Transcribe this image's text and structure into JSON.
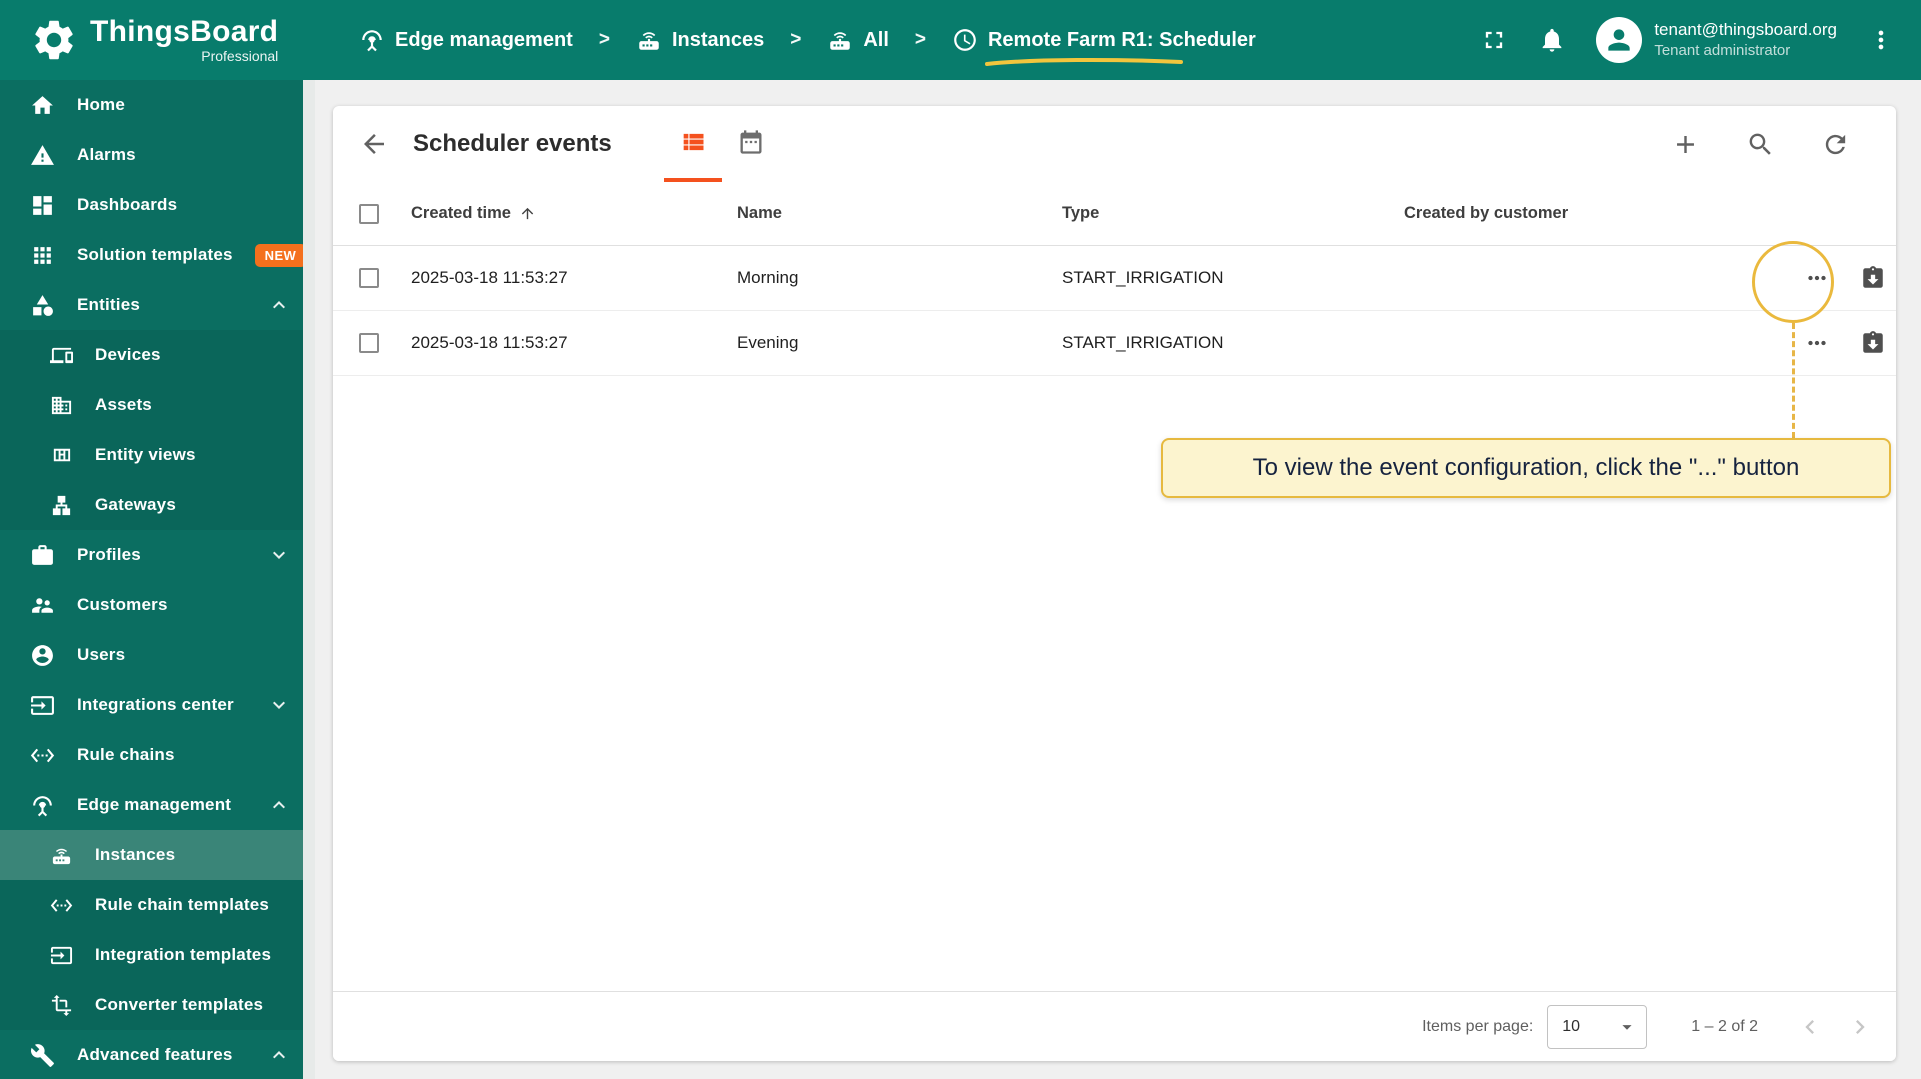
{
  "colors": {
    "header_bg": "#087c6c",
    "sidebar_bg": "#0b6e61",
    "sidebar_selected_bg": "#3a8578",
    "accent_orange": "#f4511e",
    "badge_orange": "#f4701d",
    "annotation_yellow": "#eab93d",
    "tooltip_bg": "#fcf4cf",
    "tooltip_text": "#16233f"
  },
  "header": {
    "logo_title": "ThingsBoard",
    "logo_subtitle": "Professional",
    "separator": ">",
    "breadcrumbs": [
      {
        "label": "Edge management",
        "icon": "antenna-icon"
      },
      {
        "label": "Instances",
        "icon": "router-icon"
      },
      {
        "label": "All",
        "icon": "router-icon"
      },
      {
        "label": "Remote Farm R1: Scheduler",
        "icon": "clock-icon"
      }
    ],
    "user": {
      "email": "tenant@thingsboard.org",
      "role": "Tenant administrator"
    }
  },
  "sidebar": {
    "items": [
      {
        "label": "Home",
        "icon": "home-icon"
      },
      {
        "label": "Alarms",
        "icon": "warning-icon"
      },
      {
        "label": "Dashboards",
        "icon": "dashboards-icon"
      },
      {
        "label": "Solution templates",
        "icon": "apps-icon",
        "badge": "NEW"
      },
      {
        "label": "Entities",
        "icon": "category-icon",
        "expanded": true
      },
      {
        "label": "Devices",
        "icon": "devices-icon"
      },
      {
        "label": "Assets",
        "icon": "building-icon"
      },
      {
        "label": "Entity views",
        "icon": "view-quilt-icon"
      },
      {
        "label": "Gateways",
        "icon": "lan-icon"
      },
      {
        "label": "Profiles",
        "icon": "briefcase-icon",
        "expanded": false
      },
      {
        "label": "Customers",
        "icon": "people-icon"
      },
      {
        "label": "Users",
        "icon": "person-circle-icon"
      },
      {
        "label": "Integrations center",
        "icon": "input-icon",
        "expanded": false
      },
      {
        "label": "Rule chains",
        "icon": "ethernet-icon"
      },
      {
        "label": "Edge management",
        "icon": "antenna-icon",
        "expanded": true
      },
      {
        "label": "Instances",
        "icon": "router-icon",
        "selected": true
      },
      {
        "label": "Rule chain templates",
        "icon": "ethernet-icon"
      },
      {
        "label": "Integration templates",
        "icon": "input-icon"
      },
      {
        "label": "Converter templates",
        "icon": "transform-icon"
      },
      {
        "label": "Advanced features",
        "icon": "wrench-icon",
        "expanded": true
      }
    ]
  },
  "main": {
    "title": "Scheduler events",
    "table": {
      "columns": [
        "Created time",
        "Name",
        "Type",
        "Created by customer"
      ],
      "rows": [
        {
          "created_time": "2025-03-18 11:53:27",
          "name": "Morning",
          "type": "START_IRRIGATION"
        },
        {
          "created_time": "2025-03-18 11:53:27",
          "name": "Evening",
          "type": "START_IRRIGATION"
        }
      ]
    },
    "annotation": {
      "text": "To view the event configuration, click the \"...\" button"
    },
    "pagination": {
      "items_per_page_label": "Items per page:",
      "items_per_page_value": "10",
      "range_label": "1 – 2 of 2"
    }
  }
}
